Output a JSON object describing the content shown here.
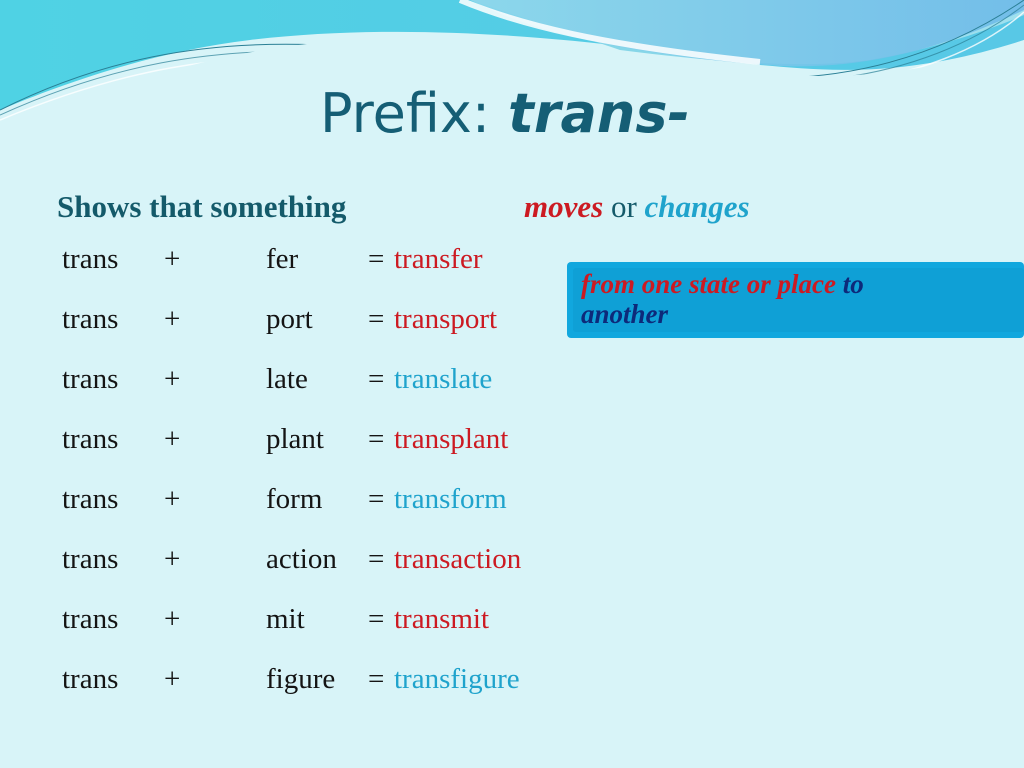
{
  "slide": {
    "title": {
      "label": "Prefix:",
      "prefix": "trans-"
    },
    "definition": {
      "lead": "Shows that something",
      "moves": "moves",
      "or": "or",
      "changes": "changes"
    },
    "callout": {
      "part1": "from one state or place",
      "part2": "to",
      "part3": "another"
    },
    "colors": {
      "title": "#155e75",
      "red": "#cc1a22",
      "cyan": "#1fa3cc",
      "navy": "#0d2a7a",
      "callout_bg": "#11a7de",
      "background": "#d8f4f8"
    },
    "rows": [
      {
        "base": "trans",
        "plus": "+",
        "root": "fer",
        "eq": "=",
        "word": "transfer",
        "color": "red"
      },
      {
        "base": "trans",
        "plus": "+",
        "root": "port",
        "eq": "=",
        "word": "transport",
        "color": "red"
      },
      {
        "base": "trans",
        "plus": "+",
        "root": "late",
        "eq": "=",
        "word": "translate",
        "color": "cyan"
      },
      {
        "base": "trans",
        "plus": "+",
        "root": "plant",
        "eq": "=",
        "word": "transplant",
        "color": "red"
      },
      {
        "base": "trans",
        "plus": "+",
        "root": "form",
        "eq": "=",
        "word": "transform",
        "color": "cyan"
      },
      {
        "base": "trans",
        "plus": "+",
        "root": "action",
        "eq": "=",
        "word": "transaction",
        "color": "red"
      },
      {
        "base": "trans",
        "plus": "+",
        "root": "mit",
        "eq": "=",
        "word": "transmit",
        "color": "red"
      },
      {
        "base": "trans",
        "plus": "+",
        "root": "figure",
        "eq": "=",
        "word": "transfigure",
        "color": "cyan"
      }
    ]
  }
}
